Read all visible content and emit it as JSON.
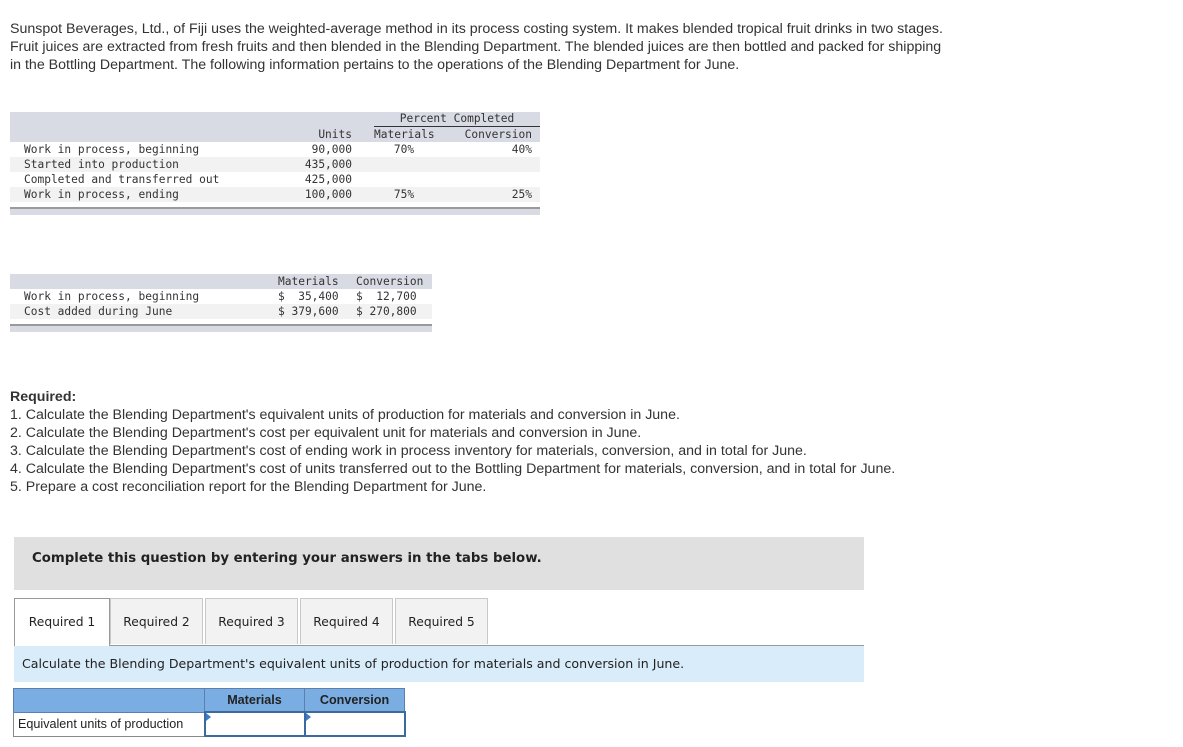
{
  "intro": "Sunspot Beverages, Ltd., of Fiji uses the weighted-average method in its process costing system. It makes blended tropical fruit drinks in two stages. Fruit juices are extracted from fresh fruits and then blended in the Blending Department. The blended juices are then bottled and packed for shipping in the Bottling Department. The following information pertains to the operations of the Blending Department for June.",
  "units_table": {
    "group_header": "Percent Completed",
    "headers": {
      "units": "Units",
      "materials": "Materials",
      "conversion": "Conversion"
    },
    "rows": [
      {
        "label": "Work in process, beginning",
        "units": "90,000",
        "materials": "70%",
        "conversion": "40%"
      },
      {
        "label": "Started into production",
        "units": "435,000",
        "materials": "",
        "conversion": ""
      },
      {
        "label": "Completed and transferred out",
        "units": "425,000",
        "materials": "",
        "conversion": ""
      },
      {
        "label": "Work in process, ending",
        "units": "100,000",
        "materials": "75%",
        "conversion": "25%"
      }
    ]
  },
  "cost_table": {
    "headers": {
      "materials": "Materials",
      "conversion": "Conversion"
    },
    "rows": [
      {
        "label": "Work in process, beginning",
        "materials": "$  35,400",
        "conversion": "$  12,700"
      },
      {
        "label": "Cost added during June",
        "materials": "$ 379,600",
        "conversion": "$ 270,800"
      }
    ]
  },
  "required": {
    "title": "Required:",
    "items": [
      "1. Calculate the Blending Department's equivalent units of production for materials and conversion in June.",
      "2. Calculate the Blending Department's cost per equivalent unit for materials and conversion in June.",
      "3. Calculate the Blending Department's cost of ending work in process inventory for materials, conversion, and in total for June.",
      "4. Calculate the Blending Department's cost of units transferred out to the Bottling Department for materials, conversion, and in total for June.",
      "5. Prepare a cost reconciliation report for the Blending Department for June."
    ]
  },
  "instruction": "Complete this question by entering your answers in the tabs below.",
  "tabs": [
    {
      "label": "Required 1",
      "active": true
    },
    {
      "label": "Required 2",
      "active": false
    },
    {
      "label": "Required 3",
      "active": false
    },
    {
      "label": "Required 4",
      "active": false
    },
    {
      "label": "Required 5",
      "active": false
    }
  ],
  "tab_prompt": "Calculate the Blending Department's equivalent units of production for materials and conversion in June.",
  "answer_table": {
    "headers": {
      "materials": "Materials",
      "conversion": "Conversion"
    },
    "row_label": "Equivalent units of production",
    "materials_value": "",
    "conversion_value": ""
  }
}
